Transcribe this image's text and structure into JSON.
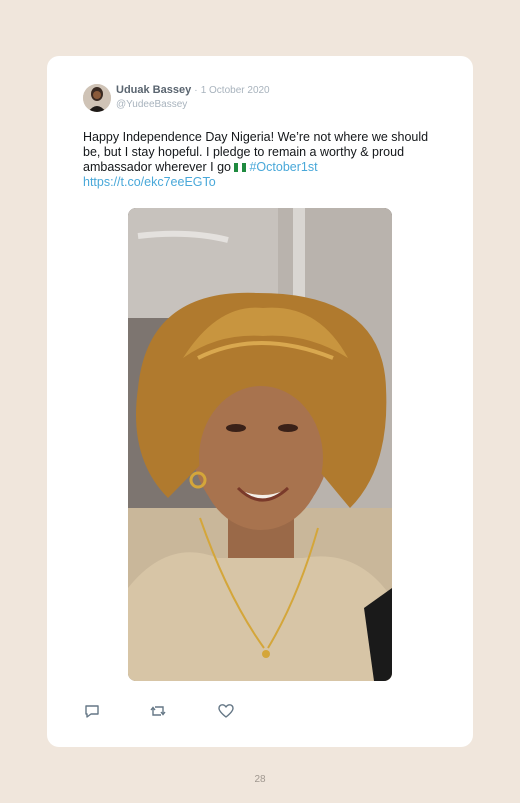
{
  "tweet": {
    "author_name": "Uduak Bassey",
    "separator": "·",
    "date": "1 October 2020",
    "handle": "@YudeeBassey",
    "text_main": "Happy Independence Day Nigeria! We’re not where we should be, but I stay hopeful. I pledge to remain a worthy & proud ambassador wherever I go",
    "hashtag": "#October1st",
    "link": "https://t.co/ekc7eeEGTo"
  },
  "icons": {
    "flag": "nigeria-flag-icon",
    "reply": "reply-icon",
    "retweet": "retweet-icon",
    "like": "heart-icon"
  },
  "colors": {
    "background": "#f0e6dc",
    "card": "#ffffff",
    "link": "#49a8d9",
    "name": "#5a6570",
    "muted": "#a8b3bd"
  },
  "page_number": "28"
}
